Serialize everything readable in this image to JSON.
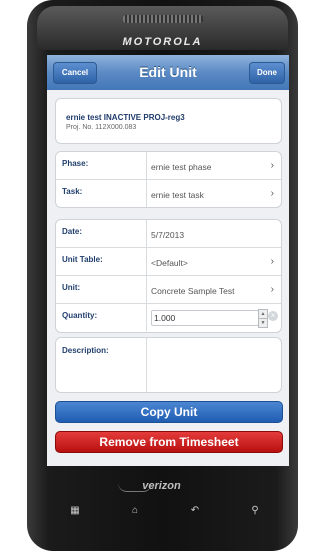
{
  "device": {
    "brand": "MOTOROLA",
    "carrier": "verizon"
  },
  "navbar": {
    "title": "Edit Unit",
    "cancel_label": "Cancel",
    "done_label": "Done"
  },
  "project": {
    "name": "ernie test INACTIVE PROJ-reg3",
    "number": "Proj. No. 112X000.083"
  },
  "fields": {
    "phase": {
      "label": "Phase:",
      "value": "ernie test phase"
    },
    "task": {
      "label": "Task:",
      "value": "ernie test task"
    },
    "date": {
      "label": "Date:",
      "value": "5/7/2013"
    },
    "unit_table": {
      "label": "Unit Table:",
      "value": "<Default>"
    },
    "unit": {
      "label": "Unit:",
      "value": "Concrete Sample Test"
    },
    "quantity": {
      "label": "Quantity:",
      "value": "1.000"
    },
    "description": {
      "label": "Description:",
      "value": ""
    }
  },
  "actions": {
    "copy_label": "Copy Unit",
    "remove_label": "Remove from Timesheet"
  },
  "colors": {
    "accent": "#1f5db3",
    "danger": "#c81414",
    "label_text": "#22406e"
  }
}
